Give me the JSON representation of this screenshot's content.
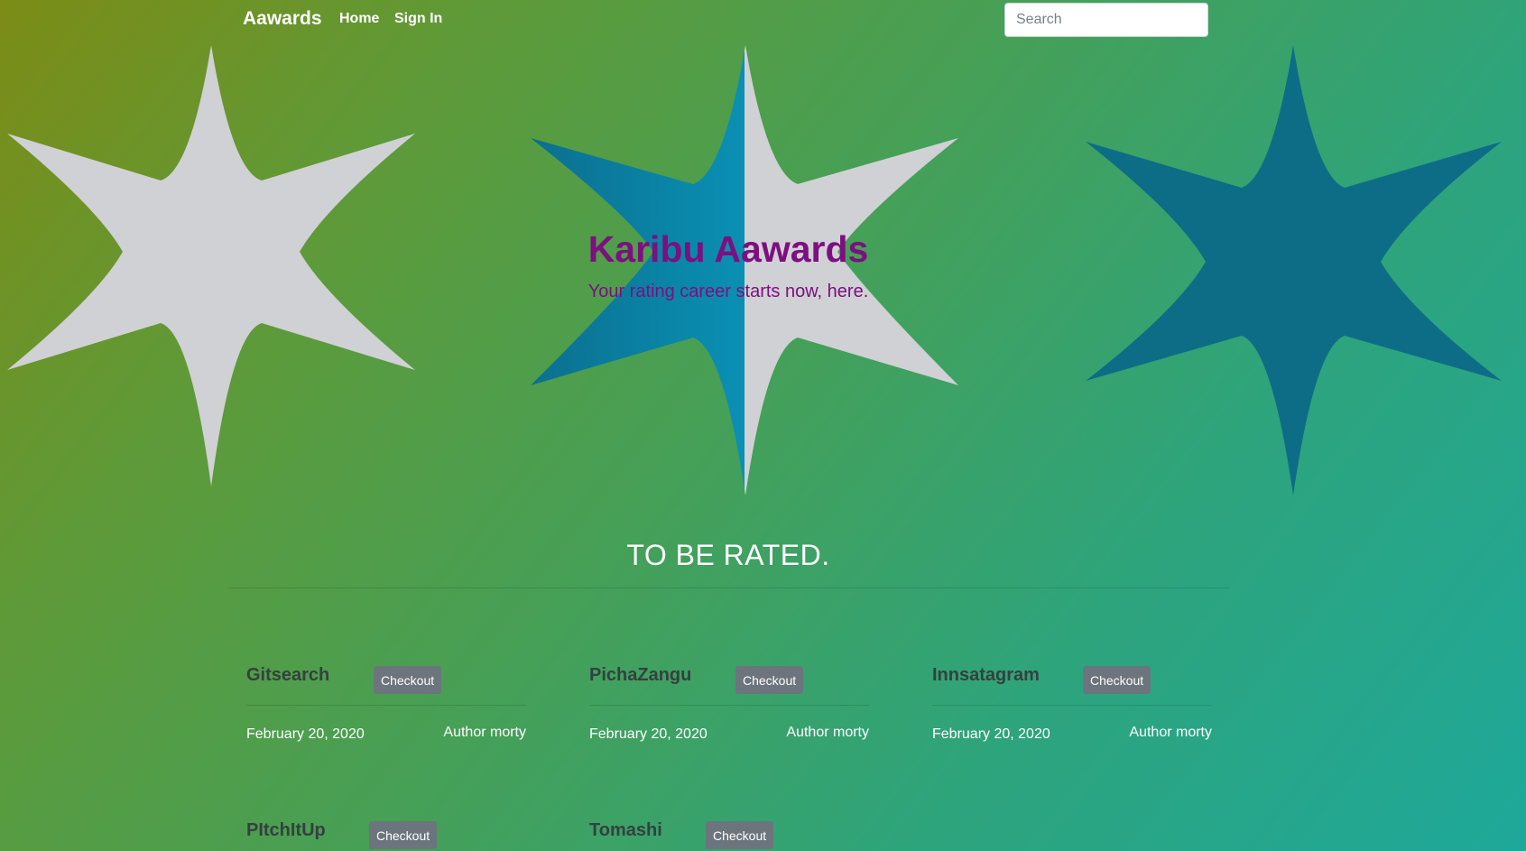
{
  "navbar": {
    "brand": "Aawards",
    "links": {
      "home": "Home",
      "sign_in": "Sign In"
    },
    "search_placeholder": "Search"
  },
  "hero": {
    "title": "Karibu Aawards",
    "subtitle": "Your rating career starts now, here."
  },
  "section": {
    "title": "TO BE RATED."
  },
  "projects": [
    {
      "title": "Gitsearch",
      "button": "Checkout",
      "date": "February 20, 2020",
      "author": "Author morty"
    },
    {
      "title": "PichaZangu",
      "button": "Checkout",
      "date": "February 20, 2020",
      "author": "Author morty"
    },
    {
      "title": "Innsatagram",
      "button": "Checkout",
      "date": "February 20, 2020",
      "author": "Author morty"
    },
    {
      "title": "PItchItUp",
      "button": "Checkout"
    },
    {
      "title": "Tomashi",
      "button": "Checkout"
    }
  ],
  "colors": {
    "hero_text": "#7d0f80",
    "star_light": "#d0d1d4",
    "star_blue": "#0b8bb0",
    "star_dark": "#0d6d86",
    "button": "#6c757d"
  },
  "icons": [
    "star-icon-left",
    "star-icon-center",
    "star-icon-right"
  ]
}
